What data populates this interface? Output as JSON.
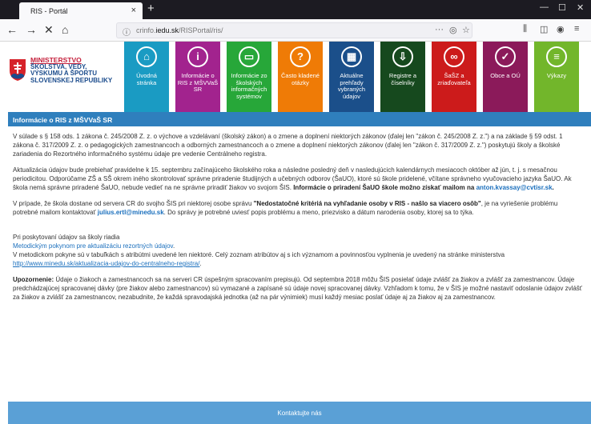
{
  "browser": {
    "tab_title": "RIS - Portál",
    "tab_close": "×",
    "new_tab": "+",
    "url_prefix": "crinfo.",
    "url_domain": "iedu.sk",
    "url_path": "/RISPortal/ris/",
    "url_actions": "···",
    "win_min": "—",
    "win_max": "☐",
    "win_close": "✕"
  },
  "header": {
    "ministry_line1": "MINISTERSTVO",
    "ministry_line2": "ŠKOLSTVA, VEDY,",
    "ministry_line3": "VÝSKUMU A ŠPORTU",
    "ministry_line4": "SLOVENSKEJ REPUBLIKY"
  },
  "nav": {
    "tiles": [
      {
        "label": "Úvodná stránka",
        "icon": "home-icon",
        "glyph": "⌂"
      },
      {
        "label": "Informácie o RIS z MŠVVaŠ SR",
        "icon": "info-icon",
        "glyph": "i"
      },
      {
        "label": "Informácie zo školských informačných systémov",
        "icon": "monitor-icon",
        "glyph": "▭"
      },
      {
        "label": "Často kladené otázky",
        "icon": "question-icon",
        "glyph": "?"
      },
      {
        "label": "Aktuálne prehľady vybraných údajov",
        "icon": "calculator-icon",
        "glyph": "▦"
      },
      {
        "label": "Registre a číselníky",
        "icon": "download-icon",
        "glyph": "⇩"
      },
      {
        "label": "ŠaŠZ a zriaďovateľa",
        "icon": "link-icon",
        "glyph": "∞"
      },
      {
        "label": "Obce a OÚ",
        "icon": "check-icon",
        "glyph": "✓"
      },
      {
        "label": "Výkazy",
        "icon": "list-icon",
        "glyph": "≡"
      }
    ]
  },
  "section": {
    "title": "Informácie o RIS z MŠVVaŠ SR"
  },
  "content": {
    "p1": "V súlade s § 158 ods. 1 zákona č. 245/2008 Z. z. o výchove a vzdelávaní (školský zákon) a o zmene a doplnení niektorých zákonov (ďalej len \"zákon č. 245/2008 Z. z.\") a na základe § 59 odst. 1 zákona č. 317/2009 Z. z. o pedagogických zamestnancoch a odborných zamestnancoch a o zmene a doplnení niektorých zákonov (ďalej len \"zákon č. 317/2009 Z. z.\") poskytujú školy a školské zariadenia do Rezortného informačného systému údaje pre vedenie Centrálneho registra.",
    "p2_text": "Aktualizácia údajov bude prebiehať pravidelne k 15. septembru začínajúceho školského roka a následne posledný deň v nasledujúcich kalendárnych mesiacoch október až jún, t. j. s mesačnou periodicitou. Odporúčame ZŠ a SŠ okrem iného skontrolovať správne priradenie študijných a učebných odborov (ŠaUO), ktoré sú škole pridelené, včítane správneho vyučovacieho jazyka ŠaUO. Ak škola nemá správne priradené ŠaUO, nebude vedieť na ne správne priradiť žiakov vo svojom ŠIS.",
    "p2_bold": "Informácie o priradení ŠaUO škole možno získať mailom na",
    "p2_mail": "anton.kvassay@cvtisr.sk",
    "p2_end": ".",
    "p3_start": "V prípade, že škola dostane od servera CR do svojho ŠIS pri niektorej osobe správu",
    "p3_bold": "\"Nedostatočné kritériá na vyhľadanie osoby v RIS - našlo sa viacero osôb\"",
    "p3_mid": ", je na vyriešenie problému potrebné mailom kontaktovať",
    "p3_mail": "julius.ertl@minedu.sk",
    "p3_end": ". Do správy je potrebné uviesť popis problému a meno, priezvisko a dátum narodenia osoby, ktorej sa to týka.",
    "p4_start": "Pri poskytovaní údajov sa školy riadia",
    "p4_link": "Metodickým pokynom pre aktualizáciu rezortných údajov",
    "p4_mid": ".\nV metodickom pokyne sú v tabuľkách s atribútmi uvedené len niektoré. Celý zoznam atribútov aj s ich významom a povinnosťou vyplnenia je uvedený na stránke ministerstva",
    "p4_url": "http://www.minedu.sk/aktualizacia-udajov-do-centralneho-registra/",
    "p4_end": ".",
    "p5_bold": "Upozornenie:",
    "p5_text": "Údaje o žiakoch a zamestnancoch sa na serveri CR úspešným spracovaním prepisujú. Od septembra 2018 môžu ŠIS posielať údaje zvlášť za žiakov a zvlášť za zamestnancov. Údaje predchádzajúcej spracovanej dávky (pre žiakov alebo zamestnancov) sú vymazané a zapísané sú údaje novej spracovanej dávky. Vzhľadom k tomu, že v ŠIS je možné nastaviť odoslanie údajov zvlášť za žiakov a zvlášť za zamestnancov, nezabudnite, že každá spravodajská jednotka (až na pár výnimiek) musí každý mesiac poslať údaje aj za žiakov aj za zamestnancov."
  },
  "footer": {
    "contact_label": "Kontaktujte nás"
  }
}
